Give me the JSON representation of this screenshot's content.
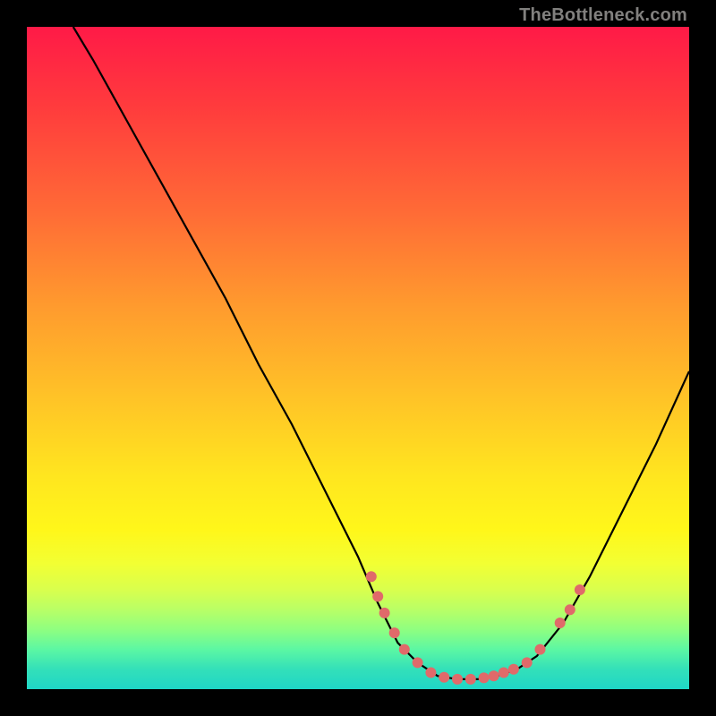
{
  "attribution": "TheBottleneck.com",
  "chart_data": {
    "type": "line",
    "title": "",
    "xlabel": "",
    "ylabel": "",
    "xlim": [
      0,
      100
    ],
    "ylim": [
      0,
      100
    ],
    "curve_points": [
      {
        "x": 7,
        "y": 100
      },
      {
        "x": 10,
        "y": 95
      },
      {
        "x": 15,
        "y": 86
      },
      {
        "x": 20,
        "y": 77
      },
      {
        "x": 25,
        "y": 68
      },
      {
        "x": 30,
        "y": 59
      },
      {
        "x": 35,
        "y": 49
      },
      {
        "x": 40,
        "y": 40
      },
      {
        "x": 45,
        "y": 30
      },
      {
        "x": 50,
        "y": 20
      },
      {
        "x": 53,
        "y": 13
      },
      {
        "x": 56,
        "y": 7
      },
      {
        "x": 59,
        "y": 4
      },
      {
        "x": 62,
        "y": 2
      },
      {
        "x": 65,
        "y": 1.5
      },
      {
        "x": 68,
        "y": 1.5
      },
      {
        "x": 71,
        "y": 2
      },
      {
        "x": 74,
        "y": 3
      },
      {
        "x": 77,
        "y": 5
      },
      {
        "x": 81,
        "y": 10
      },
      {
        "x": 85,
        "y": 17
      },
      {
        "x": 90,
        "y": 27
      },
      {
        "x": 95,
        "y": 37
      },
      {
        "x": 100,
        "y": 48
      }
    ],
    "markers": [
      {
        "x": 52,
        "y": 17
      },
      {
        "x": 53,
        "y": 14
      },
      {
        "x": 54,
        "y": 11.5
      },
      {
        "x": 55.5,
        "y": 8.5
      },
      {
        "x": 57,
        "y": 6
      },
      {
        "x": 59,
        "y": 4
      },
      {
        "x": 61,
        "y": 2.5
      },
      {
        "x": 63,
        "y": 1.8
      },
      {
        "x": 65,
        "y": 1.5
      },
      {
        "x": 67,
        "y": 1.5
      },
      {
        "x": 69,
        "y": 1.7
      },
      {
        "x": 70.5,
        "y": 2
      },
      {
        "x": 72,
        "y": 2.5
      },
      {
        "x": 73.5,
        "y": 3
      },
      {
        "x": 75.5,
        "y": 4
      },
      {
        "x": 77.5,
        "y": 6
      },
      {
        "x": 80.5,
        "y": 10
      },
      {
        "x": 82,
        "y": 12
      },
      {
        "x": 83.5,
        "y": 15
      }
    ],
    "curve_color": "#000000",
    "marker_color": "#e06a6a",
    "marker_radius_px": 6
  }
}
